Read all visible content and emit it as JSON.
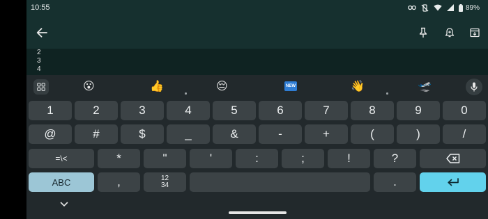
{
  "status": {
    "time": "10:55",
    "battery": "89%"
  },
  "toolbar": {
    "back": "back-arrow-icon",
    "pin": "pin-icon",
    "reminder": "bell-plus-icon",
    "archive": "archive-icon"
  },
  "note": {
    "lines": [
      "2",
      "3",
      "4"
    ]
  },
  "suggestions": {
    "emojis": [
      "😮",
      "👍",
      "😔",
      "🆕",
      "👋",
      "🛫"
    ],
    "new_badge": "NEW"
  },
  "keyboard": {
    "row1": [
      "1",
      "2",
      "3",
      "4",
      "5",
      "6",
      "7",
      "8",
      "9",
      "0"
    ],
    "row2": [
      "@",
      "#",
      "$",
      "_",
      "&",
      "-",
      "+",
      "(",
      ")",
      "/"
    ],
    "row3": [
      "=\\<",
      "*",
      "\"",
      "'",
      ":",
      ";",
      "!",
      "?"
    ],
    "row4": {
      "abc": "ABC",
      "comma": ",",
      "fraction_top": "12",
      "fraction_bottom": "34",
      "period": "."
    }
  },
  "colors": {
    "header": "#16302f",
    "keyboard": "#22292c",
    "key": "#3c4346",
    "abc_key": "#9cc6d6",
    "enter_key": "#62d2ec"
  }
}
